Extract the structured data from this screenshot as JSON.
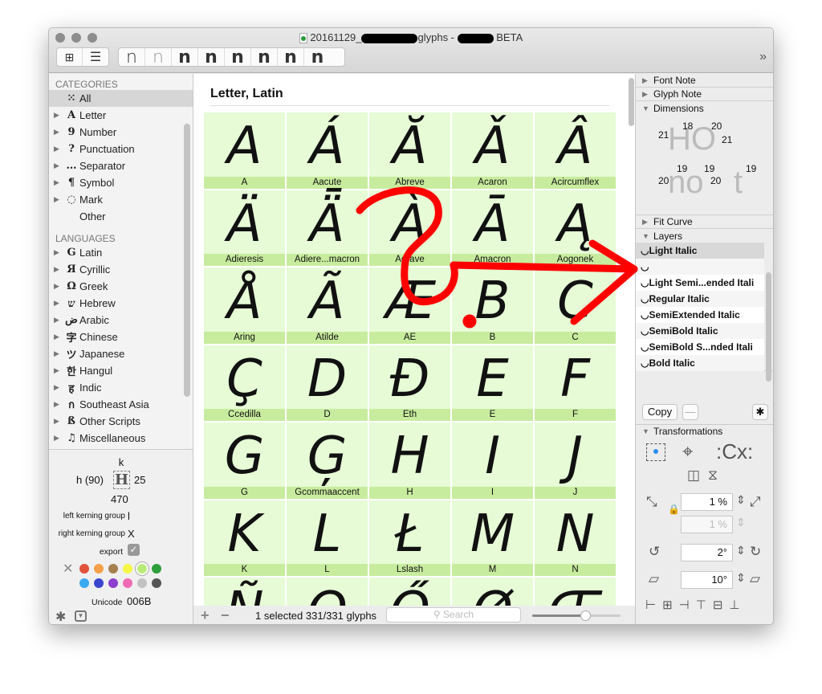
{
  "window": {
    "title_prefix": "20161129_",
    "title_mid": "glyphs - ",
    "title_suffix": "BETA",
    "doc_icon": "glyphs-file-icon"
  },
  "toolbar": {
    "grid_view": "grid-view-icon",
    "list_view": "list-view-icon",
    "weights": [
      "n",
      "n",
      "n",
      "n",
      "n",
      "n",
      "n",
      "n"
    ],
    "overflow": "»"
  },
  "sidebar": {
    "categories_label": "CATEGORIES",
    "categories": [
      {
        "icon": "⁙",
        "label": "All"
      },
      {
        "icon": "A",
        "label": "Letter"
      },
      {
        "icon": "9",
        "label": "Number"
      },
      {
        "icon": "?",
        "label": "Punctuation"
      },
      {
        "icon": "…",
        "label": "Separator"
      },
      {
        "icon": "¶",
        "label": "Symbol"
      },
      {
        "icon": "◌",
        "label": "Mark"
      },
      {
        "icon": "",
        "label": "Other"
      }
    ],
    "languages_label": "LANGUAGES",
    "languages": [
      {
        "icon": "G",
        "label": "Latin"
      },
      {
        "icon": "Я",
        "label": "Cyrillic"
      },
      {
        "icon": "Ω",
        "label": "Greek"
      },
      {
        "icon": "ש",
        "label": "Hebrew"
      },
      {
        "icon": "ض",
        "label": "Arabic"
      },
      {
        "icon": "字",
        "label": "Chinese"
      },
      {
        "icon": "ツ",
        "label": "Japanese"
      },
      {
        "icon": "한",
        "label": "Hangul"
      },
      {
        "icon": "ह",
        "label": "Indic"
      },
      {
        "icon": "ก",
        "label": "Southeast Asia"
      },
      {
        "icon": "ß",
        "label": "Other Scripts"
      },
      {
        "icon": "♫",
        "label": "Miscellaneous"
      }
    ]
  },
  "info": {
    "glyph": "k",
    "left_sb": "h (90)",
    "right_sb": "25",
    "width": "470",
    "left_kern_label": "left kerning group",
    "left_kern": "l",
    "right_kern_label": "right kerning group",
    "right_kern": "X",
    "export_label": "export",
    "export_checked": true,
    "unicode_label": "Unicode",
    "unicode": "006B",
    "colors": [
      "#e0533a",
      "#f6a14a",
      "#a6804f",
      "#f6f646",
      "#b9ec7a",
      "#2f9e3c",
      "#3aa8ef",
      "#3b46cf",
      "#8e3fcf",
      "#f06bb5",
      "#c2c2c2",
      "#555555"
    ],
    "selected_color": "#b9ec7a"
  },
  "main": {
    "section_title": "Letter, Latin",
    "glyphs": [
      {
        "g": "A",
        "n": "A"
      },
      {
        "g": "Á",
        "n": "Aacute"
      },
      {
        "g": "Ă",
        "n": "Abreve"
      },
      {
        "g": "Ǎ",
        "n": "Acaron"
      },
      {
        "g": "Â",
        "n": "Acircumflex"
      },
      {
        "g": "Ä",
        "n": "Adieresis"
      },
      {
        "g": "Ǟ",
        "n": "Adiere...macron"
      },
      {
        "g": "À",
        "n": "Agrave"
      },
      {
        "g": "Ā",
        "n": "Amacron"
      },
      {
        "g": "Ą",
        "n": "Aogonek"
      },
      {
        "g": "Å",
        "n": "Aring"
      },
      {
        "g": "Ã",
        "n": "Atilde"
      },
      {
        "g": "Æ",
        "n": "AE"
      },
      {
        "g": "B",
        "n": "B"
      },
      {
        "g": "C",
        "n": "C"
      },
      {
        "g": "Ç",
        "n": "Ccedilla"
      },
      {
        "g": "D",
        "n": "D"
      },
      {
        "g": "Đ",
        "n": "Eth"
      },
      {
        "g": "E",
        "n": "E"
      },
      {
        "g": "F",
        "n": "F"
      },
      {
        "g": "G",
        "n": "G"
      },
      {
        "g": "Ģ",
        "n": "Gcommaaccent"
      },
      {
        "g": "H",
        "n": "H"
      },
      {
        "g": "I",
        "n": "I"
      },
      {
        "g": "J",
        "n": "J"
      },
      {
        "g": "K",
        "n": "K"
      },
      {
        "g": "L",
        "n": "L"
      },
      {
        "g": "Ł",
        "n": "Lslash"
      },
      {
        "g": "M",
        "n": "M"
      },
      {
        "g": "N",
        "n": "N"
      },
      {
        "g": "Ñ",
        "n": ""
      },
      {
        "g": "O",
        "n": ""
      },
      {
        "g": "Ő",
        "n": ""
      },
      {
        "g": "Ø",
        "n": ""
      },
      {
        "g": "Œ",
        "n": ""
      }
    ]
  },
  "bottom": {
    "add": "+",
    "remove": "−",
    "status": "1 selected 331/331 glyphs",
    "search_placeholder": "Search",
    "zoom_slider": 0.6
  },
  "right": {
    "font_note": "Font Note",
    "glyph_note": "Glyph Note",
    "dimensions": "Dimensions",
    "dim_values": {
      "H_left": "21",
      "H_stem": "18",
      "O_stem": "20",
      "O_right": "21",
      "n_left": "20",
      "n_stem": "19",
      "o_stem": "19",
      "o_right": "20",
      "t_stem": "19"
    },
    "fit_curve": "Fit Curve",
    "layers_label": "Layers",
    "layers": [
      "Light Italic",
      "",
      "Light Semi...ended Itali",
      "Regular Italic",
      "SemiExtended Italic",
      "SemiBold Italic",
      "SemiBold S...nded Itali",
      "Bold Italic"
    ],
    "copy": "Copy",
    "minus": "—",
    "transformations": "Transformations",
    "scale_x": "1 %",
    "scale_y": "1 %",
    "rotate": "2°",
    "slant": "10°"
  },
  "annotation_color": "#ff0000"
}
